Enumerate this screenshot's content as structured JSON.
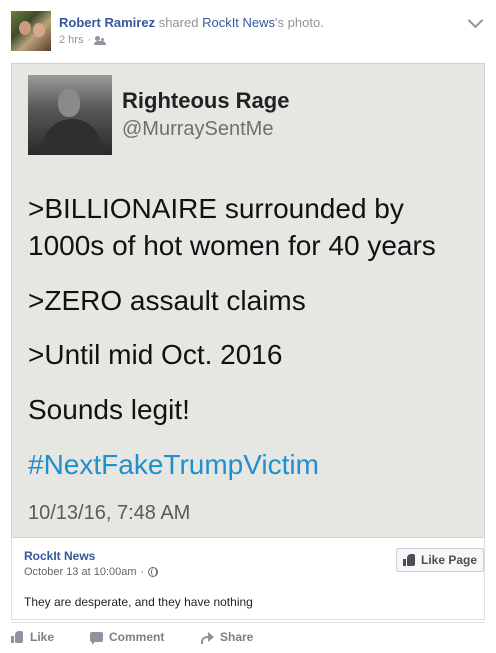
{
  "post": {
    "author": "Robert Ramirez",
    "shared_text": "shared",
    "page_name": "RockIt News",
    "suffix": "'s photo.",
    "time": "2 hrs",
    "audience_icon": "friends-icon"
  },
  "tweet": {
    "name": "Righteous Rage",
    "handle": "@MurraySentMe",
    "lines": [
      ">BILLIONAIRE surrounded by",
      "1000s of hot women for 40 years",
      ">ZERO assault claims",
      ">Until mid Oct. 2016",
      "Sounds legit!"
    ],
    "hashtag": "#NextFakeTrumpVictim",
    "date": "10/13/16, 7:48 AM",
    "hashtag_color": "#1f8fcf"
  },
  "attribution": {
    "page": "RockIt News",
    "date": "October 13 at 10:00am",
    "date_separator": "·",
    "caption": "They are desperate, and they have nothing",
    "like_page_label": "Like Page"
  },
  "actions": {
    "like": "Like",
    "comment": "Comment",
    "share": "Share"
  },
  "colors": {
    "link": "#365899",
    "muted": "#90949c"
  }
}
